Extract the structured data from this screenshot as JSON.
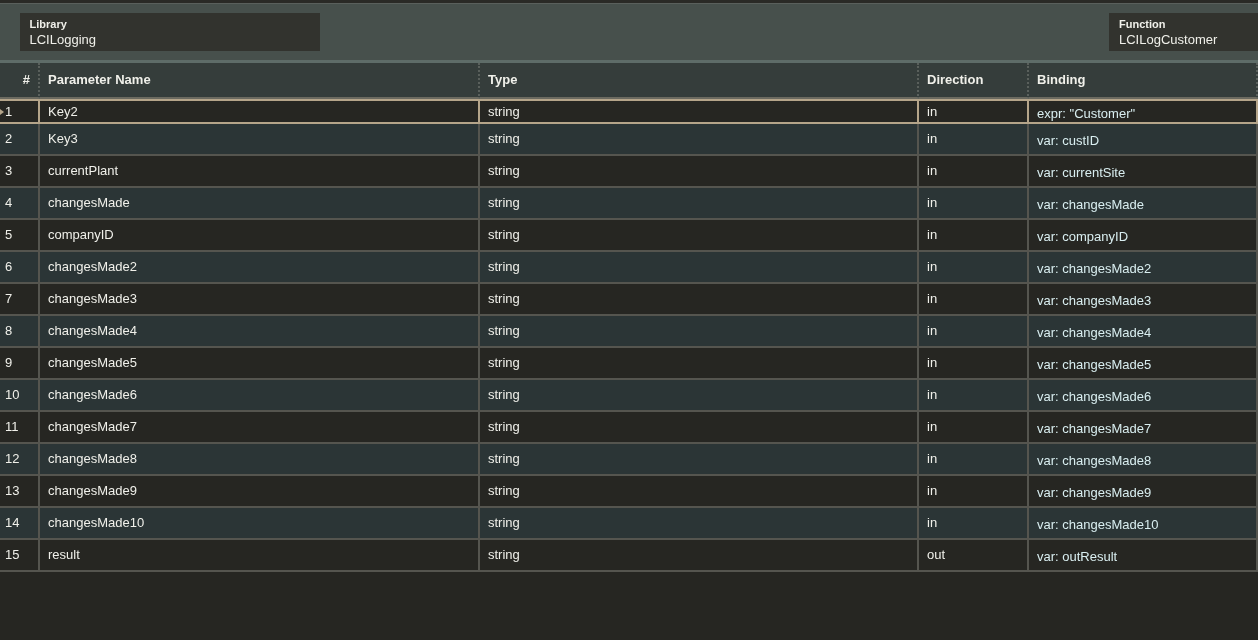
{
  "library": {
    "label": "Library",
    "value": "LCILogging"
  },
  "function": {
    "label": "Function",
    "value": "LCILogCustomer"
  },
  "table": {
    "columns": [
      "#",
      "Parameter Name",
      "Type",
      "Direction",
      "Binding"
    ],
    "rows": [
      {
        "num": "1",
        "name": "Key2",
        "type": "string",
        "direction": "in",
        "binding": "expr: \"Customer\"",
        "selected": true
      },
      {
        "num": "2",
        "name": "Key3",
        "type": "string",
        "direction": "in",
        "binding": "var: custID",
        "selected": false
      },
      {
        "num": "3",
        "name": "currentPlant",
        "type": "string",
        "direction": "in",
        "binding": "var: currentSite",
        "selected": false
      },
      {
        "num": "4",
        "name": "changesMade",
        "type": "string",
        "direction": "in",
        "binding": "var: changesMade",
        "selected": false
      },
      {
        "num": "5",
        "name": "companyID",
        "type": "string",
        "direction": "in",
        "binding": "var: companyID",
        "selected": false
      },
      {
        "num": "6",
        "name": "changesMade2",
        "type": "string",
        "direction": "in",
        "binding": "var: changesMade2",
        "selected": false
      },
      {
        "num": "7",
        "name": "changesMade3",
        "type": "string",
        "direction": "in",
        "binding": "var: changesMade3",
        "selected": false
      },
      {
        "num": "8",
        "name": "changesMade4",
        "type": "string",
        "direction": "in",
        "binding": "var: changesMade4",
        "selected": false
      },
      {
        "num": "9",
        "name": "changesMade5",
        "type": "string",
        "direction": "in",
        "binding": "var: changesMade5",
        "selected": false
      },
      {
        "num": "10",
        "name": "changesMade6",
        "type": "string",
        "direction": "in",
        "binding": "var: changesMade6",
        "selected": false
      },
      {
        "num": "11",
        "name": "changesMade7",
        "type": "string",
        "direction": "in",
        "binding": "var: changesMade7",
        "selected": false
      },
      {
        "num": "12",
        "name": "changesMade8",
        "type": "string",
        "direction": "in",
        "binding": "var: changesMade8",
        "selected": false
      },
      {
        "num": "13",
        "name": "changesMade9",
        "type": "string",
        "direction": "in",
        "binding": "var: changesMade9",
        "selected": false
      },
      {
        "num": "14",
        "name": "changesMade10",
        "type": "string",
        "direction": "in",
        "binding": "var: changesMade10",
        "selected": false
      },
      {
        "num": "15",
        "name": "result",
        "type": "string",
        "direction": "out",
        "binding": "var: outResult",
        "selected": false
      }
    ]
  }
}
